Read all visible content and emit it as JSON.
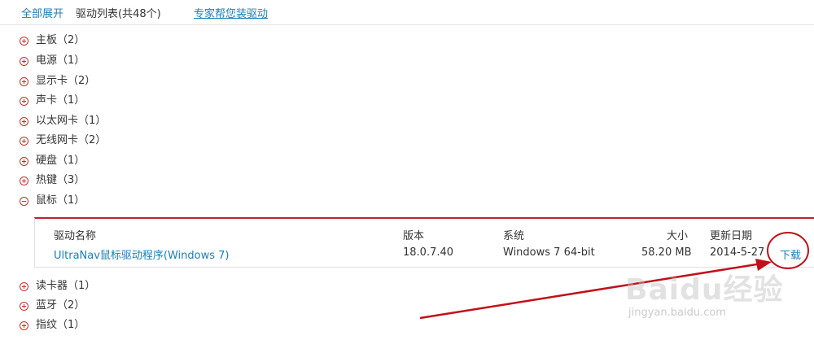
{
  "header": {
    "expand_all": "全部展开",
    "driver_list": "驱动列表(共48个)",
    "expert_help": "专家帮您装驱动"
  },
  "categories_top": [
    {
      "label": "主板（2）"
    },
    {
      "label": "电源（1）"
    },
    {
      "label": "显示卡（2）"
    },
    {
      "label": "声卡（1）"
    },
    {
      "label": "以太网卡（1）"
    },
    {
      "label": "无线网卡（2）"
    },
    {
      "label": "硬盘（1）"
    },
    {
      "label": "热键（3）"
    }
  ],
  "expanded_category": {
    "label": "鼠标（1）"
  },
  "driver_table": {
    "headers": {
      "name": "驱动名称",
      "version": "版本",
      "system": "系统",
      "size": "大小",
      "date": "更新日期"
    },
    "rows": [
      {
        "name": "UltraNav鼠标驱动程序(Windows 7)",
        "version": "18.0.7.40",
        "system": "Windows 7 64-bit",
        "size": "58.20 MB",
        "date": "2014-5-27",
        "download": "下载"
      }
    ]
  },
  "categories_bottom": [
    {
      "label": "读卡器（1）"
    },
    {
      "label": "蓝牙（2）"
    },
    {
      "label": "指纹（1）"
    }
  ],
  "annotation": {
    "color": "#c0111b"
  },
  "watermark": {
    "title": "Baidu经验",
    "sub": "jingyan.baidu.com"
  }
}
